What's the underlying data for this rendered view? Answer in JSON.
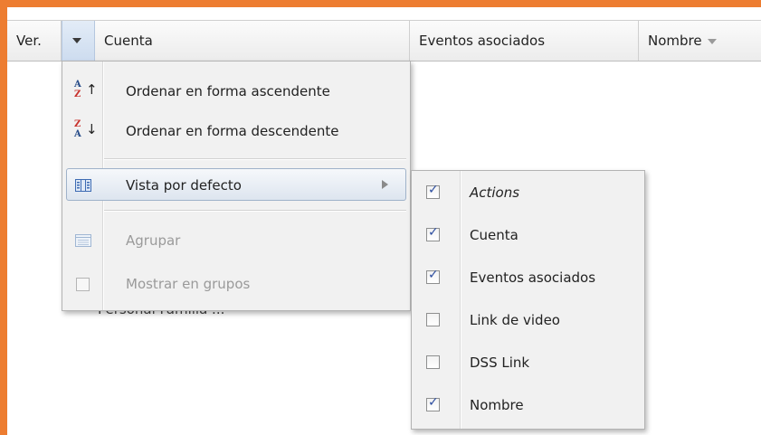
{
  "header": {
    "col_ver": "Ver.",
    "col_cuenta": "Cuenta",
    "col_eventos": "Eventos asociados",
    "col_nombre": "Nombre"
  },
  "background_text": "Personal  Familia ...",
  "menu": {
    "sort_asc": "Ordenar en forma ascendente",
    "sort_desc": "Ordenar en forma descendente",
    "default_view": "Vista por defecto",
    "group": "Agrupar",
    "show_groups": "Mostrar en grupos",
    "icons": {
      "sort_asc": "sort-az-icon",
      "sort_desc": "sort-za-icon",
      "default_view": "columns-icon",
      "group": "group-icon",
      "show_groups": "checkbox-icon"
    }
  },
  "submenu": {
    "items": [
      {
        "label": "Actions",
        "checked": true
      },
      {
        "label": "Cuenta",
        "checked": true
      },
      {
        "label": "Eventos asociados",
        "checked": true
      },
      {
        "label": "Link de video",
        "checked": false
      },
      {
        "label": "DSS Link",
        "checked": false
      },
      {
        "label": "Nombre",
        "checked": true
      }
    ]
  },
  "colors": {
    "frame_border": "#ed7d31",
    "menu_bg": "#f1f1f1",
    "check": "#2d4ea0"
  }
}
